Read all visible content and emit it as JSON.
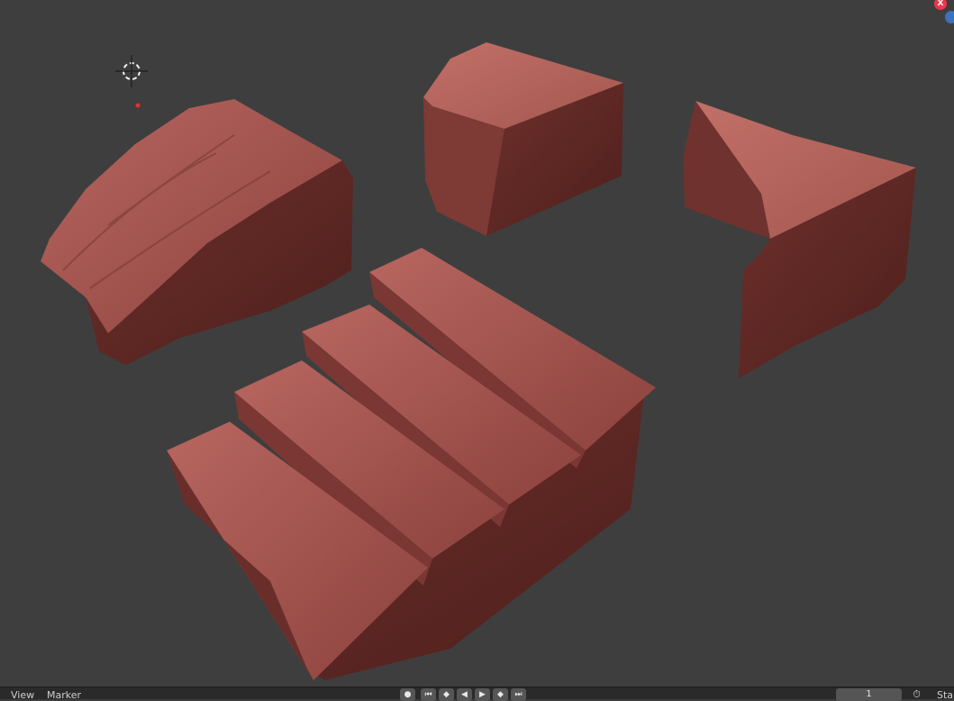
{
  "viewport": {
    "background": "#3e3e3e",
    "objects": [
      "curved-rock-block",
      "rock-cube-block",
      "rock-wedge-block",
      "stone-staircase"
    ],
    "material_color": "#9b4c48"
  },
  "gizmo": {
    "x_label": "X",
    "x_color": "#f0344a",
    "y_color": "#3a74c0"
  },
  "timeline": {
    "view_label": "View",
    "marker_label": "Marker",
    "current_frame": "1",
    "start_label": "Sta",
    "icons": [
      "record-icon",
      "jump-start-icon",
      "jump-key-back-icon",
      "play-reverse-icon",
      "play-icon",
      "jump-key-forward-icon",
      "jump-end-icon",
      "clock-icon"
    ]
  }
}
